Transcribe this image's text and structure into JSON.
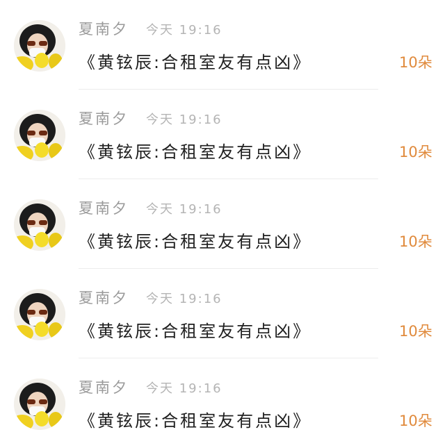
{
  "comments": [
    {
      "user_name": "夏南夕",
      "timestamp": "今天 19:16",
      "message": "《黄铉辰:合租室友有点凶》",
      "reward": "10朵"
    },
    {
      "user_name": "夏南夕",
      "timestamp": "今天 19:16",
      "message": "《黄铉辰:合租室友有点凶》",
      "reward": "10朵"
    },
    {
      "user_name": "夏南夕",
      "timestamp": "今天 19:16",
      "message": "《黄铉辰:合租室友有点凶》",
      "reward": "10朵"
    },
    {
      "user_name": "夏南夕",
      "timestamp": "今天 19:16",
      "message": "《黄铉辰:合租室友有点凶》",
      "reward": "10朵"
    },
    {
      "user_name": "夏南夕",
      "timestamp": "今天 19:16",
      "message": "《黄铉辰:合租室友有点凶》",
      "reward": "10朵"
    }
  ],
  "colors": {
    "name": "#9a9a9a",
    "timestamp": "#b4b4b4",
    "message": "#1f1f1f",
    "reward": "#e08a3c",
    "divider": "#ececec"
  }
}
